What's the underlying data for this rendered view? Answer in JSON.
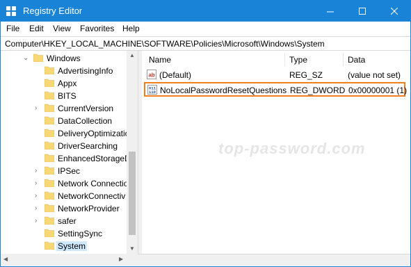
{
  "window": {
    "title": "Registry Editor",
    "accent_color": "#1883d7",
    "controls": {
      "minimize_icon": "minimize-icon",
      "maximize_icon": "maximize-icon",
      "close_icon": "close-icon"
    }
  },
  "menu": {
    "items": [
      "File",
      "Edit",
      "View",
      "Favorites",
      "Help"
    ]
  },
  "address": {
    "path": "Computer\\HKEY_LOCAL_MACHINE\\SOFTWARE\\Policies\\Microsoft\\Windows\\System"
  },
  "tree": {
    "parent": {
      "label": "Windows",
      "expanded": true
    },
    "items": [
      {
        "label": "AdvertisingInfo",
        "expandable": false
      },
      {
        "label": "Appx",
        "expandable": false
      },
      {
        "label": "BITS",
        "expandable": false
      },
      {
        "label": "CurrentVersion",
        "expandable": true
      },
      {
        "label": "DataCollection",
        "expandable": false
      },
      {
        "label": "DeliveryOptimizatio",
        "expandable": false
      },
      {
        "label": "DriverSearching",
        "expandable": false
      },
      {
        "label": "EnhancedStorageD",
        "expandable": false
      },
      {
        "label": "IPSec",
        "expandable": true
      },
      {
        "label": "Network Connectio",
        "expandable": true
      },
      {
        "label": "NetworkConnectiv",
        "expandable": true
      },
      {
        "label": "NetworkProvider",
        "expandable": true
      },
      {
        "label": "safer",
        "expandable": true
      },
      {
        "label": "SettingSync",
        "expandable": false
      },
      {
        "label": "System",
        "expandable": false,
        "selected": true
      }
    ]
  },
  "list": {
    "columns": {
      "name": "Name",
      "type": "Type",
      "data": "Data"
    },
    "rows": [
      {
        "name": "(Default)",
        "type": "REG_SZ",
        "data": "(value not set)",
        "icon": "string-value-icon"
      },
      {
        "name": "NoLocalPasswordResetQuestions",
        "type": "REG_DWORD",
        "data": "0x00000001 (1)",
        "icon": "dword-value-icon",
        "highlighted": true
      }
    ]
  },
  "watermark": "top-password.com",
  "highlight_color": "#f0801e"
}
